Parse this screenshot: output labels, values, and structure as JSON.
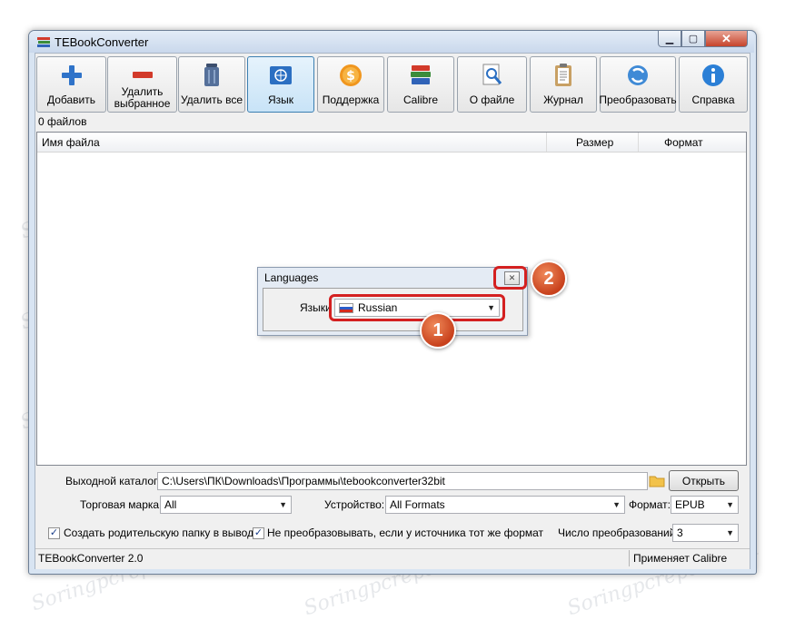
{
  "window": {
    "title": "TEBookConverter",
    "caption_close": "✕"
  },
  "toolbar": [
    {
      "label": "Добавить",
      "icon": "add-plus-icon"
    },
    {
      "label": "Удалить\nвыбранное",
      "icon": "remove-minus-icon"
    },
    {
      "label": "Удалить все",
      "icon": "trash-icon"
    },
    {
      "label": "Язык",
      "icon": "globe-flag-icon",
      "active": true
    },
    {
      "label": "Поддержка",
      "icon": "dollar-coin-icon"
    },
    {
      "label": "Calibre",
      "icon": "books-icon"
    },
    {
      "label": "О файле",
      "icon": "magnifier-icon"
    },
    {
      "label": "Журнал",
      "icon": "clipboard-icon"
    },
    {
      "label": "Преобразовать",
      "icon": "convert-arrows-icon"
    },
    {
      "label": "Справка",
      "icon": "info-icon"
    }
  ],
  "files_count": "0 файлов",
  "columns": {
    "name": "Имя файла",
    "size": "Размер",
    "format": "Формат"
  },
  "output": {
    "label": "Выходной каталог:",
    "path": "C:\\Users\\ПК\\Downloads\\Программы\\tebookconverter32bit",
    "open_button": "Открыть"
  },
  "brand": {
    "label": "Торговая марка:",
    "value": "All"
  },
  "device": {
    "label": "Устройство:",
    "value": "All Formats"
  },
  "format": {
    "label": "Формат:",
    "value": "EPUB"
  },
  "options": {
    "create_parent": "Создать родительскую папку в выводе",
    "no_convert_same": "Не преобразовывать, если у источника тот же формат",
    "conversions_label": "Число преобразований:",
    "conversions_value": "3"
  },
  "status": {
    "left": "TEBookConverter 2.0",
    "right": "Применяет Calibre"
  },
  "dialog": {
    "title": "Languages",
    "lang_label": "Языки",
    "lang_value": "Russian"
  },
  "annotations": {
    "badge1": "1",
    "badge2": "2"
  },
  "watermark": "Soringpcrepair.com",
  "colors": {
    "highlight": "#d42020",
    "badge": "#d9532a",
    "active_tab": "#c8e3f7"
  }
}
